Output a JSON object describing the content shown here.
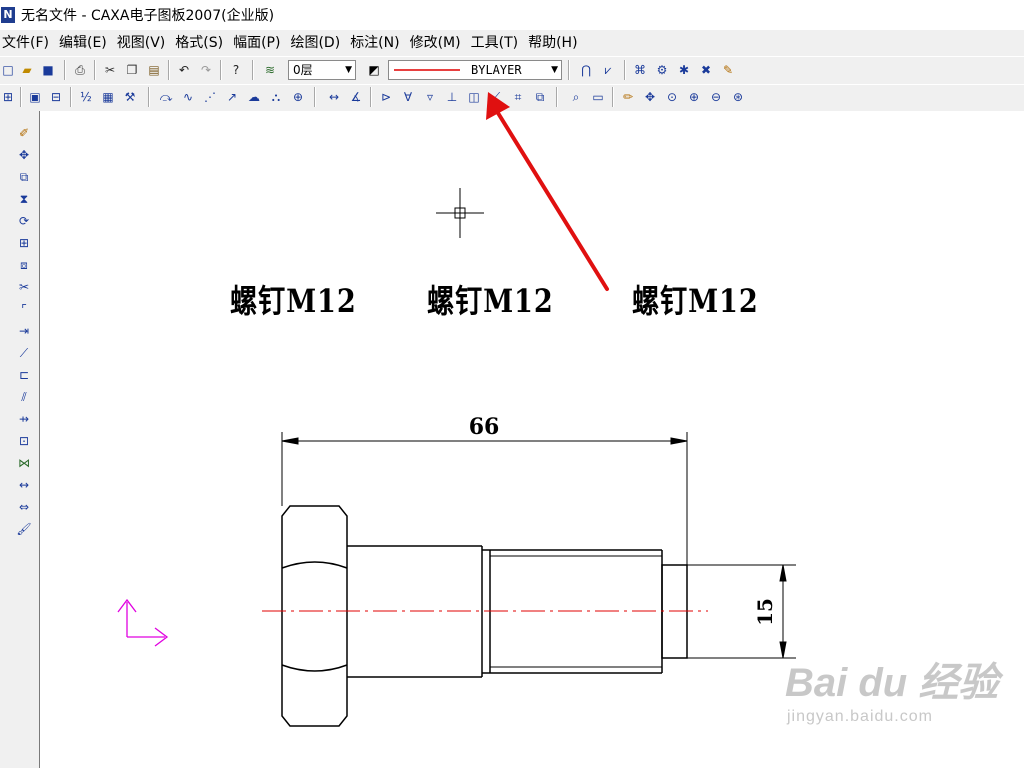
{
  "window": {
    "title": "无名文件 - CAXA电子图板2007(企业版)",
    "app_icon_letter": "N"
  },
  "menu": [
    "文件(F)",
    "编辑(E)",
    "视图(V)",
    "格式(S)",
    "幅面(P)",
    "绘图(D)",
    "标注(N)",
    "修改(M)",
    "工具(T)",
    "帮助(H)"
  ],
  "toolbar": {
    "layer_value": "0层",
    "linetype_value": "BYLAYER",
    "line_color": "#e00000"
  },
  "drawing": {
    "labels": [
      "螺钉M12",
      "螺钉M12",
      "螺钉M12"
    ],
    "dim_length": "66",
    "dim_diameter": "15",
    "centerline_color": "#e00000",
    "ucs_color": "#e000e0",
    "arrow_color": "#e01010"
  },
  "watermark": {
    "logo": "Bai du 经验",
    "url": "jingyan.baidu.com"
  }
}
